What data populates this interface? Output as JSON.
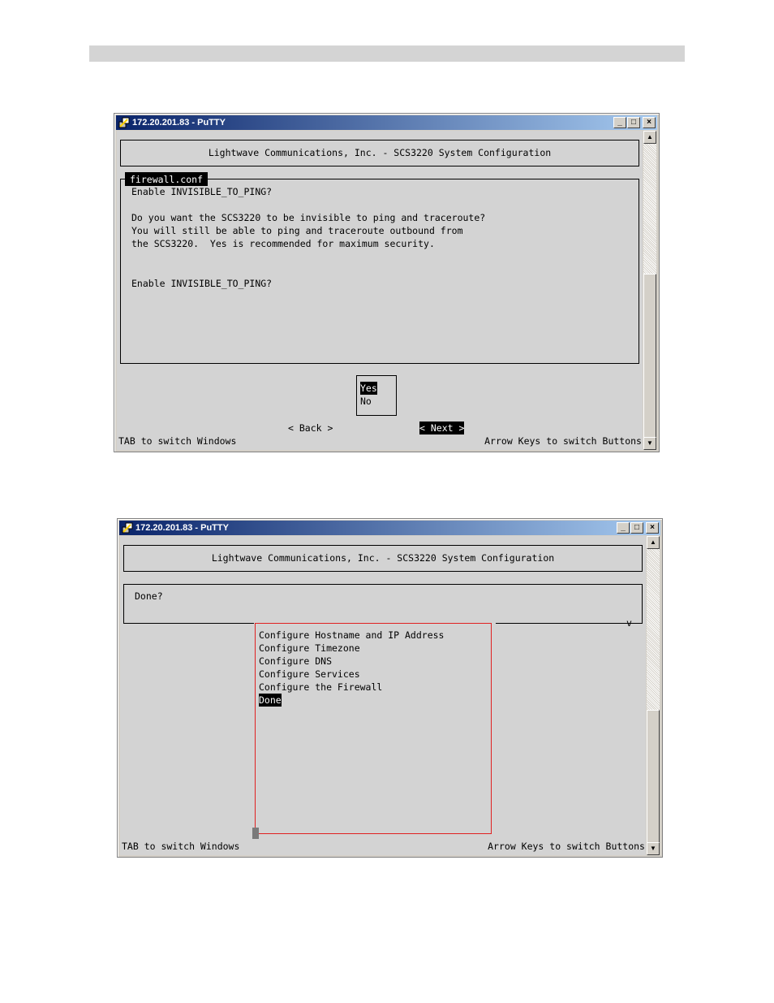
{
  "window1": {
    "title": "172.20.201.83 - PuTTY",
    "controls": {
      "minimize": "_",
      "maximize": "□",
      "close": "×"
    },
    "header": "Lightwave Communications, Inc. - SCS3220 System Configuration",
    "panel_tab": "firewall.conf",
    "body_lines": [
      "Enable INVISIBLE_TO_PING?",
      "Do you want the SCS3220 to be invisible to ping and traceroute?",
      "You will still be able to ping and traceroute outbound from",
      "the SCS3220.  Yes is recommended for maximum security.",
      "Enable INVISIBLE_TO_PING?"
    ],
    "options": {
      "yes": "Yes",
      "no": "No"
    },
    "buttons": {
      "back": "< Back >",
      "next": "< Next >"
    },
    "footer": {
      "left": "TAB to switch Windows",
      "right": "Arrow Keys to switch Buttons"
    }
  },
  "window2": {
    "title": "172.20.201.83 - PuTTY",
    "controls": {
      "minimize": "_",
      "maximize": "□",
      "close": "×"
    },
    "header": "Lightwave Communications, Inc. - SCS3220 System Configuration",
    "question": "Done?",
    "scroll_marker": "v",
    "menu_items": [
      "Configure Hostname and IP Address",
      "Configure Timezone",
      "Configure DNS",
      "Configure Services",
      "Configure the Firewall",
      "Done"
    ],
    "selected_item": "Done",
    "footer": {
      "left": "TAB to switch Windows",
      "right": "Arrow Keys to switch Buttons"
    },
    "highlight_color": "#e02020"
  }
}
